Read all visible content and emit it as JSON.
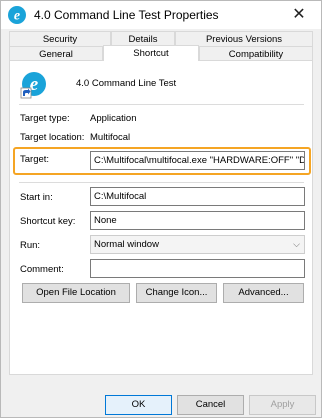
{
  "window": {
    "title": "4.0 Command Line Test Properties",
    "close_glyph": "✕"
  },
  "tabs": {
    "row1": [
      "Security",
      "Details",
      "Previous Versions"
    ],
    "row2": [
      "General",
      "Shortcut",
      "Compatibility"
    ],
    "active": "Shortcut"
  },
  "shortcut": {
    "name": "4.0 Command Line Test",
    "target_type_label": "Target type:",
    "target_type_value": "Application",
    "target_location_label": "Target location:",
    "target_location_value": "Multifocal",
    "target_label": "Target:",
    "target_value": "C:\\Multifocal\\multifocal.exe \"HARDWARE:OFF\" \"DA",
    "start_in_label": "Start in:",
    "start_in_value": "C:\\Multifocal",
    "shortcut_key_label": "Shortcut key:",
    "shortcut_key_value": "None",
    "run_label": "Run:",
    "run_value": "Normal window",
    "comment_label": "Comment:",
    "comment_value": ""
  },
  "buttons": {
    "open_file_location": "Open File Location",
    "change_icon": "Change Icon...",
    "advanced": "Advanced...",
    "ok": "OK",
    "cancel": "Cancel",
    "apply": "Apply"
  },
  "colors": {
    "highlight": "#f5a524",
    "app_icon": "#1aa3d9"
  },
  "icons": {
    "window": "app-e-icon",
    "shortcut": "app-e-shortcut-icon"
  }
}
